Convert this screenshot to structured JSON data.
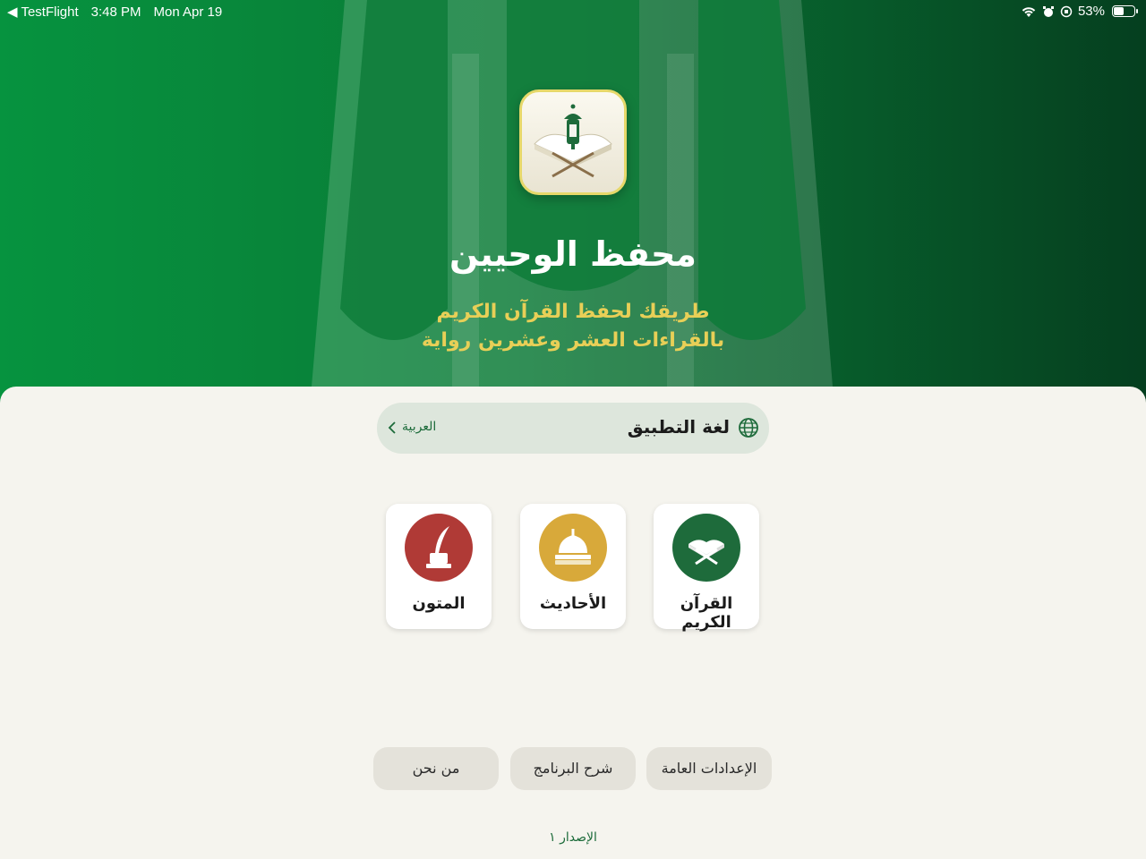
{
  "status_bar": {
    "back_app": "TestFlight",
    "time": "3:48 PM",
    "date": "Mon Apr 19",
    "battery_text": "53%",
    "battery_level": 0.53
  },
  "header": {
    "app_title": "محفظ الوحيين",
    "tagline_line1": "طريقك لحفظ القرآن الكريم",
    "tagline_line2": "بالقراءات العشر وعشرين رواية"
  },
  "language": {
    "label": "لغة التطبيق",
    "value": "العربية",
    "icon": "globe-icon"
  },
  "sections": [
    {
      "label": "القرآن الكريم",
      "icon": "quran-icon",
      "color": "#1e6b3b"
    },
    {
      "label": "الأحاديث",
      "icon": "dome-icon",
      "color": "#d8a93a"
    },
    {
      "label": "المتون",
      "icon": "quill-inkwell-icon",
      "color": "#b03a36"
    }
  ],
  "buttons": {
    "settings": "الإعدادات العامة",
    "guide": "شرح البرنامج",
    "about": "من نحن"
  },
  "version": "الإصدار ١",
  "colors": {
    "primary_green": "#0a7a36",
    "accent_gold": "#e8cf57",
    "background": "#f5f4ee"
  }
}
